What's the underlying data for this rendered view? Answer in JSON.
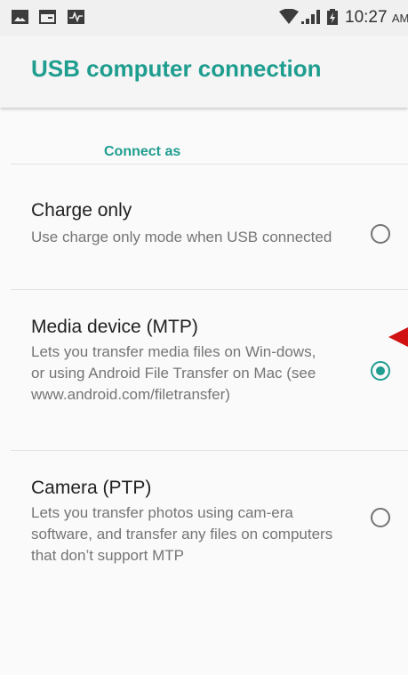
{
  "status_bar": {
    "icons": [
      "image-icon",
      "calendar-card-icon",
      "activity-icon",
      "wifi-icon",
      "signal-icon",
      "battery-icon"
    ],
    "time": "10:27",
    "ampm": "AM"
  },
  "app_bar": {
    "title": "USB computer connection"
  },
  "section": {
    "header": "Connect as"
  },
  "options": [
    {
      "title": "Charge only",
      "description": "Use charge only mode when USB connected",
      "selected": false
    },
    {
      "title": "Media device (MTP)",
      "description": "Lets you transfer media files on Win-dows, or using Android File Transfer on Mac (see www.android.com/filetransfer)",
      "selected": true
    },
    {
      "title": "Camera (PTP)",
      "description": "Lets you transfer photos using cam-era software, and transfer any files on computers that don’t support MTP",
      "selected": false
    }
  ],
  "colors": {
    "accent": "#1f9d8f",
    "annotation_arrow": "#d01212"
  }
}
